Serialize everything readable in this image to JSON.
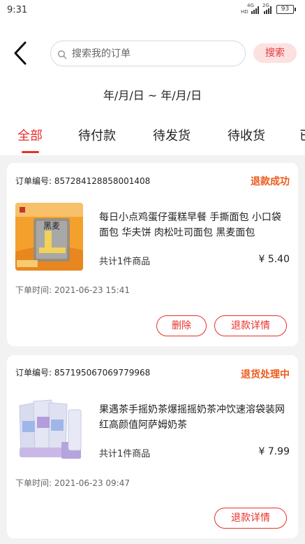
{
  "status_bar": {
    "time": "9:31",
    "net1": "4G",
    "net1b": "HD",
    "net2": "2G",
    "battery": "93"
  },
  "header": {
    "search_placeholder": "搜索我的订单",
    "search_button": "搜索"
  },
  "date_range": "年/月/日 ~ 年/月/日",
  "tabs": [
    {
      "label": "全部",
      "active": true
    },
    {
      "label": "待付款",
      "active": false
    },
    {
      "label": "待发货",
      "active": false
    },
    {
      "label": "待收货",
      "active": false
    },
    {
      "label": "已",
      "active": false
    }
  ],
  "orders": [
    {
      "order_no": "订单编号: 857284128858001408",
      "status": "退款成功",
      "product_name": "每日小点鸡蛋仔蛋糕早餐 手撕面包 小口袋面包 华夫饼 肉松吐司面包 黑麦面包",
      "thumb_text": "黑麦",
      "count": "共计1件商品",
      "price": "¥ 5.40",
      "time": "下单时间: 2021-06-23 15:41",
      "buttons": [
        "删除",
        "退款详情"
      ]
    },
    {
      "order_no": "订单编号: 857195067069779968",
      "status": "退货处理中",
      "product_name": "果遇茶手摇奶茶爆摇摇奶茶冲饮速溶袋装网红高颜值阿萨姆奶茶",
      "count": "共计1件商品",
      "price": "¥ 7.99",
      "time": "下单时间: 2021-06-23 09:47",
      "buttons": [
        "退款详情"
      ]
    }
  ]
}
